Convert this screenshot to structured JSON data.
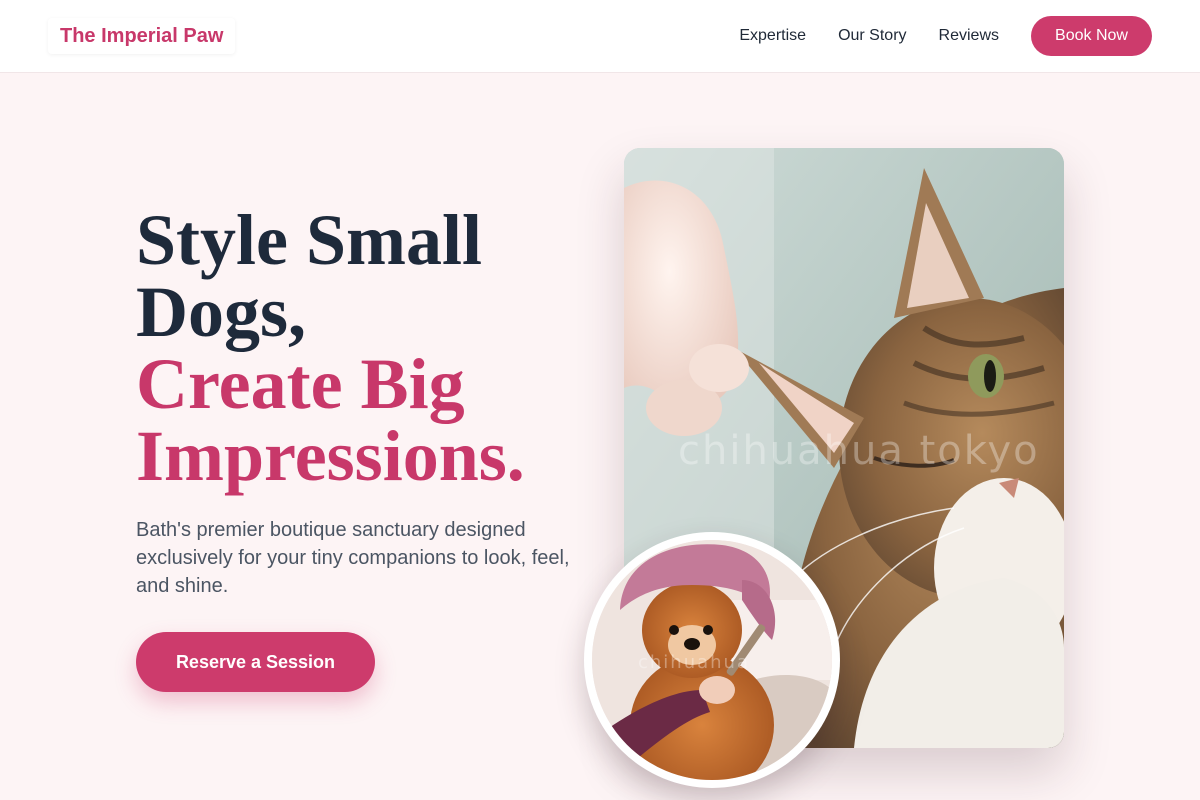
{
  "nav": {
    "brand": "The Imperial Paw",
    "links": [
      "Expertise",
      "Our Story",
      "Reviews"
    ],
    "book_label": "Book Now"
  },
  "hero": {
    "title_line1": "Style Small",
    "title_line2": "Dogs,",
    "title_accent1": "Create Big",
    "title_accent2": "Impressions.",
    "subtitle": "Bath's premier boutique sanctuary designed exclusively for your tiny companions to look, feel, and shine.",
    "cta_label": "Reserve a Session"
  },
  "images": {
    "main_photo_watermark": "chihuahua tokyo",
    "circle_photo_watermark": "chihuahua"
  },
  "colors": {
    "accent": "#cd3b6c",
    "heading": "#1e2a3b",
    "page_bg": "#fdf4f5"
  }
}
